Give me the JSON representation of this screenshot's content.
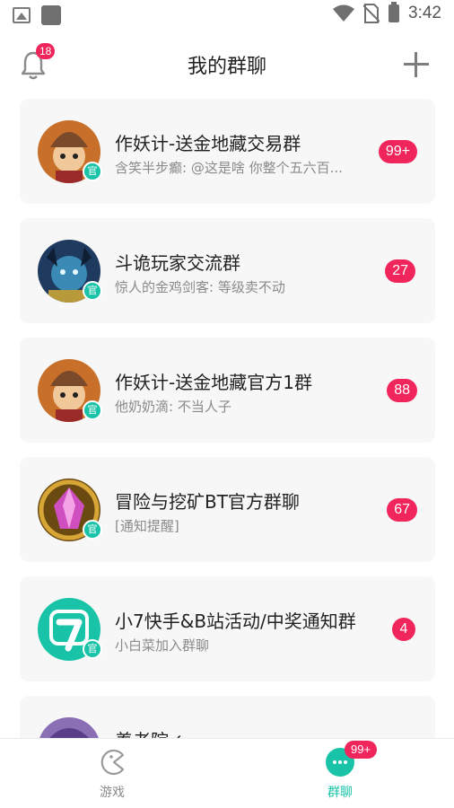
{
  "status_bar": {
    "time": "3:42",
    "icons": [
      "image-icon",
      "square-app-icon",
      "wifi-icon",
      "no-sim-icon",
      "battery-icon"
    ]
  },
  "header": {
    "title": "我的群聊",
    "notification_count": "18",
    "icons": [
      "bell-icon",
      "plus-icon"
    ]
  },
  "colors": {
    "accent": "#19c3a8",
    "badge": "#f0255b",
    "card_bg": "#f7f7f7"
  },
  "groups": [
    {
      "name": "作妖计-送金地藏交易群",
      "last_message": "含笑半步癫: @这是啥 你整个五六百...",
      "unread": "99+",
      "official": "官"
    },
    {
      "name": "斗诡玩家交流群",
      "last_message": "惊人的金鸡剑客: 等级卖不动",
      "unread": "27",
      "official": "官"
    },
    {
      "name": "作妖计-送金地藏官方1群",
      "last_message": "他奶奶滴: 不当人子",
      "unread": "88",
      "official": "官"
    },
    {
      "name": "冒险与挖矿BT官方群聊",
      "last_message": "[通知提醒]",
      "unread": "67",
      "official": "官"
    },
    {
      "name": "小7快手&B站活动/中奖通知群",
      "last_message": "小白菜加入群聊",
      "unread": "4",
      "official": "官"
    },
    {
      "name": "养老院✓",
      "last_message": "",
      "unread": "",
      "official": ""
    }
  ],
  "bottom_nav": {
    "games_label": "游戏",
    "groups_label": "群聊",
    "groups_badge": "99+"
  }
}
